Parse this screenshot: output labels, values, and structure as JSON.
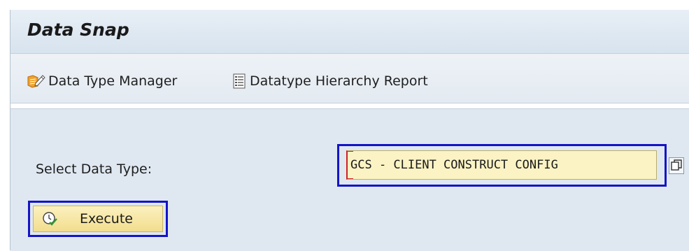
{
  "header": {
    "title": "Data Snap"
  },
  "toolbar": {
    "items": [
      {
        "label": "Data Type Manager",
        "icon": "edit-pencil-icon"
      },
      {
        "label": "Datatype Hierarchy Report",
        "icon": "report-list-icon"
      }
    ]
  },
  "form": {
    "select_label": "Select Data Type:",
    "data_type_value": "GCS - CLIENT CONSTRUCT CONFIG",
    "value_help_icon": "value-help-icon",
    "execute_label": "Execute",
    "execute_icon": "execute-clock-check-icon"
  },
  "colors": {
    "highlight_border": "#1414c8",
    "input_bg": "#fbf3c4",
    "content_bg": "#dfe8f1",
    "button_bg": "#f3dd8e"
  }
}
